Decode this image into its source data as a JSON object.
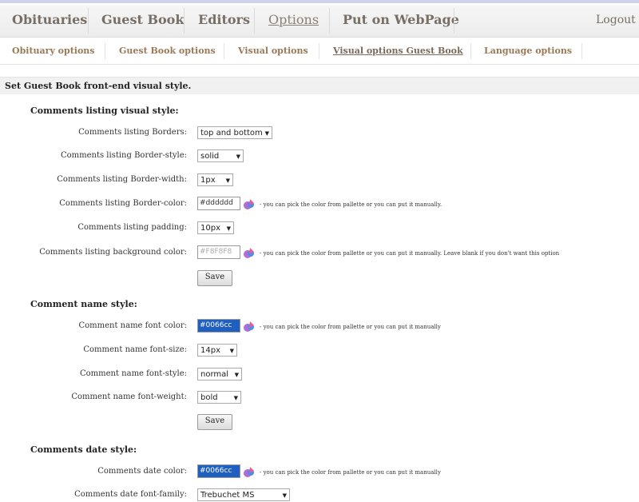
{
  "main_nav": {
    "items": [
      "Obituaries",
      "Guest Book",
      "Editors",
      "Options",
      "Put on WebPage"
    ],
    "active": "Options",
    "logout": "Logout"
  },
  "sub_nav": {
    "items": [
      "Obituary options",
      "Guest Book options",
      "Visual options",
      "Visual options Guest Book",
      "Language options"
    ],
    "active": "Visual options Guest Book"
  },
  "page_heading": "Set Guest Book front-end visual style.",
  "sections": {
    "listing": {
      "title": "Comments listing visual style:",
      "borders_label": "Comments listing Borders:",
      "borders_value": "top and bottom",
      "border_style_label": "Comments listing Border-style:",
      "border_style_value": "solid",
      "border_width_label": "Comments listing Border-width:",
      "border_width_value": "1px",
      "border_color_label": "Comments listing Border-color:",
      "border_color_value": "#dddddd",
      "border_color_note": "- you can pick the color from pallette or you can put it manually.",
      "padding_label": "Comments listing padding:",
      "padding_value": "10px",
      "bg_color_label": "Comments listing background color:",
      "bg_color_value": "#F8F8F8",
      "bg_color_note": "- you can pick the color from pallette or you can put it manually. Leave blank if you don't want this option",
      "save": "Save"
    },
    "name": {
      "title": "Comment name style:",
      "font_color_label": "Comment name font color:",
      "font_color_value": "#0066cc",
      "font_color_note": "- you can pick the color from pallette or you can put it manually",
      "font_size_label": "Comment name font-size:",
      "font_size_value": "14px",
      "font_style_label": "Comment name font-style:",
      "font_style_value": "normal",
      "font_weight_label": "Comment name font-weight:",
      "font_weight_value": "bold",
      "save": "Save"
    },
    "date": {
      "title": "Comments date style:",
      "color_label": "Comments date color:",
      "color_value": "#0066cc",
      "color_note": "- you can pick the color from pallette or you can put it manually",
      "family_label": "Comments date font-family:",
      "family_value": "Trebuchet MS"
    }
  },
  "icons": {
    "color_picker": "color-picker-icon",
    "dropdown": "chevron-down-icon"
  },
  "colors": {
    "accent_link": "#9a7a56",
    "selected_field": "#1f5fc0"
  }
}
